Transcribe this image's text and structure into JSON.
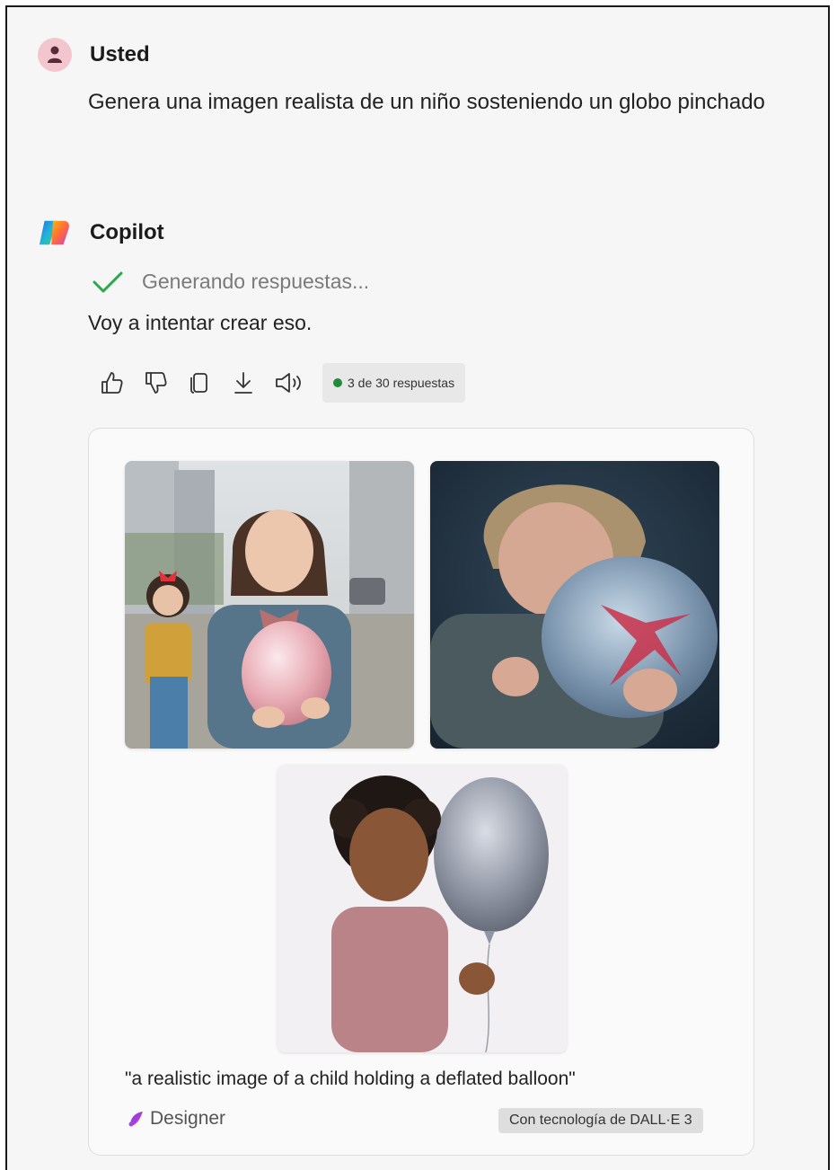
{
  "user": {
    "name": "Usted",
    "message": "Genera una imagen realista de un niño sosteniendo un globo pinchado"
  },
  "copilot": {
    "name": "Copilot",
    "status": "Generando respuestas...",
    "reply": "Voy a intentar crear eso.",
    "actions": {
      "like_icon": "thumbs-up-icon",
      "dislike_icon": "thumbs-down-icon",
      "copy_icon": "copy-icon",
      "download_icon": "download-icon",
      "read_aloud_icon": "speaker-icon"
    },
    "counter": "3 de 30 respuestas"
  },
  "card": {
    "prompt": "\"a realistic image of a child holding a deflated balloon\"",
    "brand": "Designer",
    "powered_by": "Con tecnología de DALL·E 3"
  },
  "colors": {
    "background": "#f6f6f6",
    "status_green": "#1f8c3b",
    "check_green": "#2aa84a",
    "user_avatar": "#f3c6cf"
  }
}
